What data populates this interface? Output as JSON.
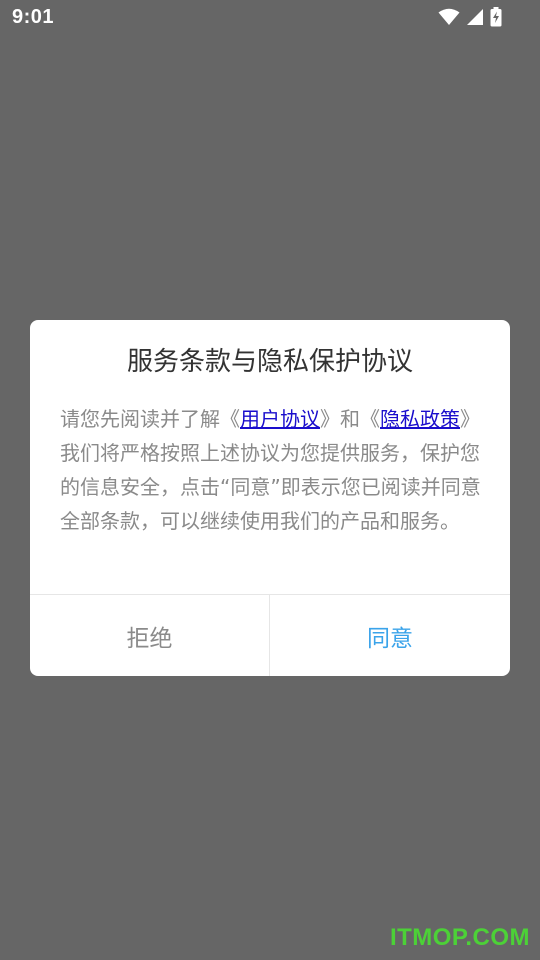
{
  "status_bar": {
    "time": "9:01",
    "icons": [
      "wifi-icon",
      "cell-signal-icon",
      "battery-charging-icon"
    ]
  },
  "dialog": {
    "title": "服务条款与隐私保护协议",
    "body": {
      "part1": "请您先阅读并了解《",
      "link1": "用户协议",
      "part2": "》和《",
      "link2": "隐私政策",
      "part3": "》我们将严格按照上述协议为您提供服务，保护您的信息安全，点击“同意”即表示您已阅读并同意全部条款，可以继续使用我们的产品和服务。"
    },
    "reject_label": "拒绝",
    "agree_label": "同意"
  },
  "watermark": "ITMOP.COM",
  "colors": {
    "overlay": "#666666",
    "link": "#1a0dcc",
    "agree": "#3aa3ea",
    "watermark": "#4cd137"
  }
}
